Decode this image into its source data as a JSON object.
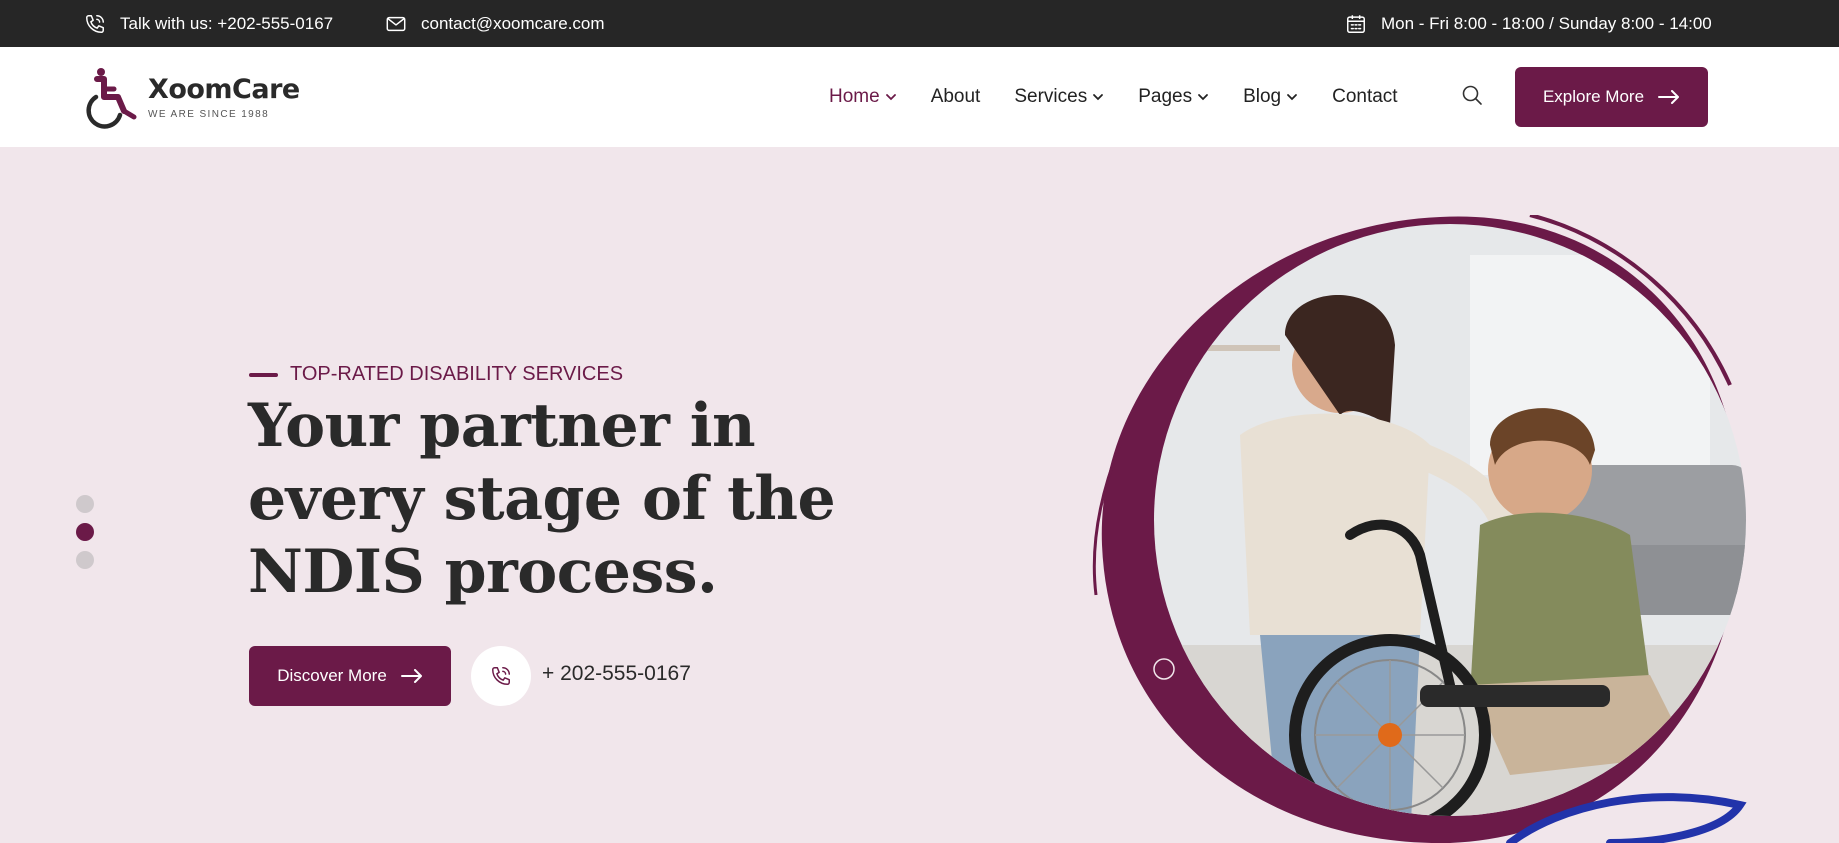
{
  "topbar": {
    "phone_text": "Talk with us: +202-555-0167",
    "email_text": "contact@xoomcare.com",
    "hours_text": "Mon - Fri 8:00 - 18:00 / Sunday 8:00 - 14:00"
  },
  "header": {
    "brand": "XoomCare",
    "tagline": "WE ARE SINCE 1988",
    "nav": [
      {
        "label": "Home",
        "has_dropdown": true,
        "active": true
      },
      {
        "label": "About",
        "has_dropdown": false
      },
      {
        "label": "Services",
        "has_dropdown": true
      },
      {
        "label": "Pages",
        "has_dropdown": true
      },
      {
        "label": "Blog",
        "has_dropdown": true
      },
      {
        "label": "Contact",
        "has_dropdown": false
      }
    ],
    "cta_label": "Explore More"
  },
  "hero": {
    "eyebrow": "TOP-RATED DISABILITY SERVICES",
    "headline": "Your partner in every stage of the NDIS process.",
    "button_label": "Discover More",
    "phone": "+ 202-555-0167",
    "slide_count": 3,
    "active_slide": 2
  },
  "colors": {
    "brand": "#6b1a48",
    "topbar_bg": "#262626",
    "hero_bg": "#f1e6eb",
    "accent_squiggle": "#2233aa"
  },
  "icons": {
    "phone": "phone-icon",
    "email": "email-icon",
    "calendar": "calendar-icon",
    "search": "search-icon",
    "arrow": "arrow-right-icon",
    "chevron": "chevron-down-icon"
  }
}
